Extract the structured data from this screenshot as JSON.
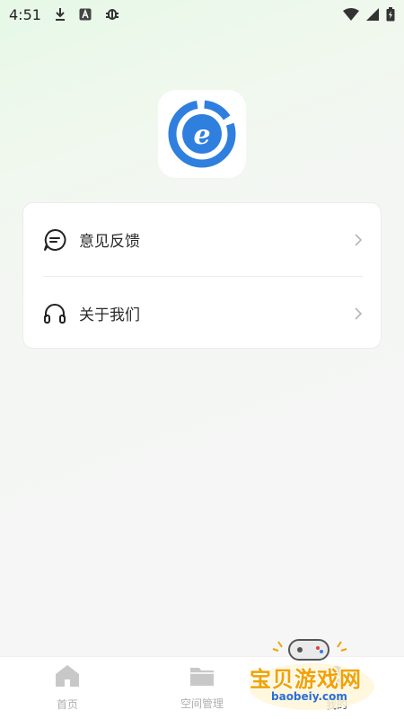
{
  "status_bar": {
    "time": "4:51",
    "left_icons": [
      "download-icon",
      "a-icon",
      "bug-icon"
    ],
    "right_icons": [
      "wifi-icon",
      "signal-icon",
      "battery-icon"
    ]
  },
  "app_logo": {
    "letter": "e",
    "color": "#2f7fde"
  },
  "menu": {
    "items": [
      {
        "label": "意见反馈",
        "icon": "feedback-chat-icon"
      },
      {
        "label": "关于我们",
        "icon": "headphones-icon"
      }
    ]
  },
  "bottom_nav": {
    "items": [
      {
        "label": "首页",
        "icon": "home-icon",
        "active": false
      },
      {
        "label": "空间管理",
        "icon": "folder-icon",
        "active": false
      },
      {
        "label": "我的",
        "icon": "profile-icon",
        "active": true
      }
    ]
  },
  "watermark": {
    "title": "宝贝游戏网",
    "url": "baobeiy.com"
  },
  "colors": {
    "accent": "#2f7fde",
    "text": "#2a2a2a",
    "muted": "#b0b0b0",
    "watermark": "#f2a200"
  }
}
